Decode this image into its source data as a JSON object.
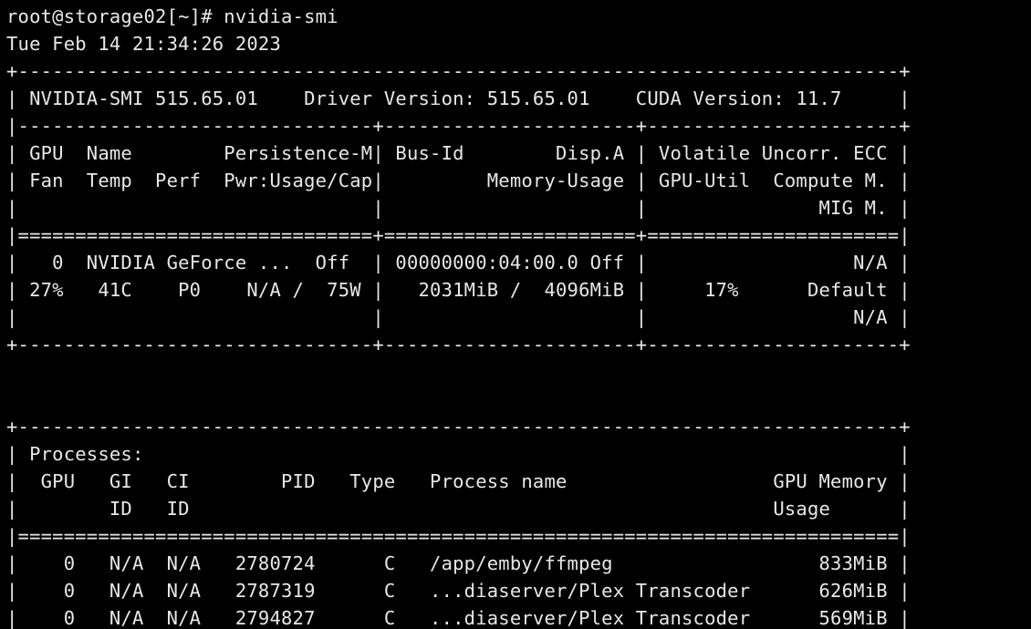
{
  "terminal": {
    "background": "#000000",
    "foreground": "#e8e8e8",
    "lines": [
      {
        "name": "prompt-command-line",
        "text": "root@storage02[~]# nvidia-smi"
      },
      {
        "name": "timestamp-line",
        "text": "Tue Feb 14 21:34:26 2023"
      },
      {
        "name": "table-top-border",
        "text": "+-----------------------------------------------------------------------------+"
      },
      {
        "name": "version-header-line",
        "text": "| NVIDIA-SMI 515.65.01    Driver Version: 515.65.01    CUDA Version: 11.7     |"
      },
      {
        "name": "header-separator",
        "text": "|-------------------------------+----------------------+----------------------+"
      },
      {
        "name": "gpu-column-header-1",
        "text": "| GPU  Name        Persistence-M| Bus-Id        Disp.A | Volatile Uncorr. ECC |"
      },
      {
        "name": "gpu-column-header-2",
        "text": "| Fan  Temp  Perf  Pwr:Usage/Cap|         Memory-Usage | GPU-Util  Compute M. |"
      },
      {
        "name": "gpu-column-header-3",
        "text": "|                               |                      |               MIG M. |"
      },
      {
        "name": "gpu-header-double-separator",
        "text": "|===============================+======================+======================|"
      },
      {
        "name": "gpu-row-line-1",
        "text": "|   0  NVIDIA GeForce ...  Off  | 00000000:04:00.0 Off |                  N/A |"
      },
      {
        "name": "gpu-row-line-2",
        "text": "| 27%   41C    P0    N/A /  75W |   2031MiB /  4096MiB |     17%      Default |"
      },
      {
        "name": "gpu-row-line-3",
        "text": "|                               |                      |                  N/A |"
      },
      {
        "name": "gpu-table-bottom-border",
        "text": "+-------------------------------+----------------------+----------------------+"
      },
      {
        "name": "blank-line-1",
        "text": ""
      },
      {
        "name": "blank-line-2",
        "text": ""
      },
      {
        "name": "processes-top-border",
        "text": "+-----------------------------------------------------------------------------+"
      },
      {
        "name": "processes-title-line",
        "text": "| Processes:                                                                  |"
      },
      {
        "name": "processes-column-header-1",
        "text": "|  GPU   GI   CI        PID   Type   Process name                  GPU Memory |"
      },
      {
        "name": "processes-column-header-2",
        "text": "|        ID   ID                                                   Usage      |"
      },
      {
        "name": "processes-double-separator",
        "text": "|=============================================================================|"
      },
      {
        "name": "process-row-1",
        "text": "|    0   N/A  N/A   2780724      C   /app/emby/ffmpeg                  833MiB |"
      },
      {
        "name": "process-row-2",
        "text": "|    0   N/A  N/A   2787319      C   ...diaserver/Plex Transcoder      626MiB |"
      },
      {
        "name": "process-row-3",
        "text": "|    0   N/A  N/A   2794827      C   ...diaserver/Plex Transcoder      569MiB |"
      },
      {
        "name": "processes-bottom-border",
        "text": "+-----------------------------------------------------------------------------+"
      }
    ]
  }
}
